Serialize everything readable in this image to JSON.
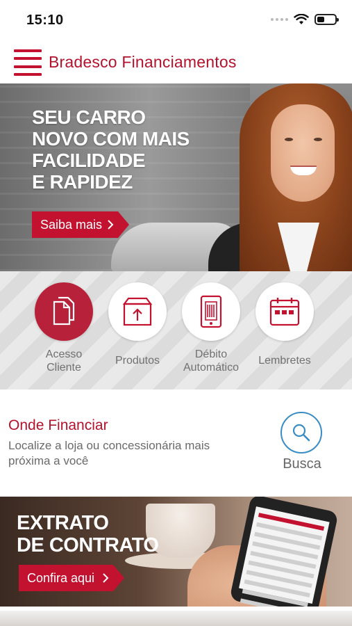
{
  "status_bar": {
    "time": "15:10"
  },
  "header": {
    "title": "Bradesco Financiamentos"
  },
  "hero": {
    "headline": [
      "SEU CARRO",
      "NOVO COM MAIS",
      "FACILIDADE",
      "E RAPIDEZ"
    ],
    "cta_label": "Saiba mais"
  },
  "shortcuts": [
    {
      "label": "Acesso Cliente",
      "icon": "documents-icon"
    },
    {
      "label": "Produtos",
      "icon": "box-upload-icon"
    },
    {
      "label": "Débito Automático",
      "icon": "barcode-phone-icon"
    },
    {
      "label": "Lembretes",
      "icon": "calendar-icon"
    }
  ],
  "find": {
    "title": "Onde Financiar",
    "description": "Localize a loja ou concessionária mais próxima a você",
    "search_label": "Busca"
  },
  "extrato": {
    "headline": [
      "EXTRATO",
      "DE CONTRATO"
    ],
    "cta_label": "Confira aqui"
  },
  "colors": {
    "brand_red": "#c3122f",
    "search_blue": "#3a8cc4",
    "text_gray": "#6a6a6a"
  }
}
